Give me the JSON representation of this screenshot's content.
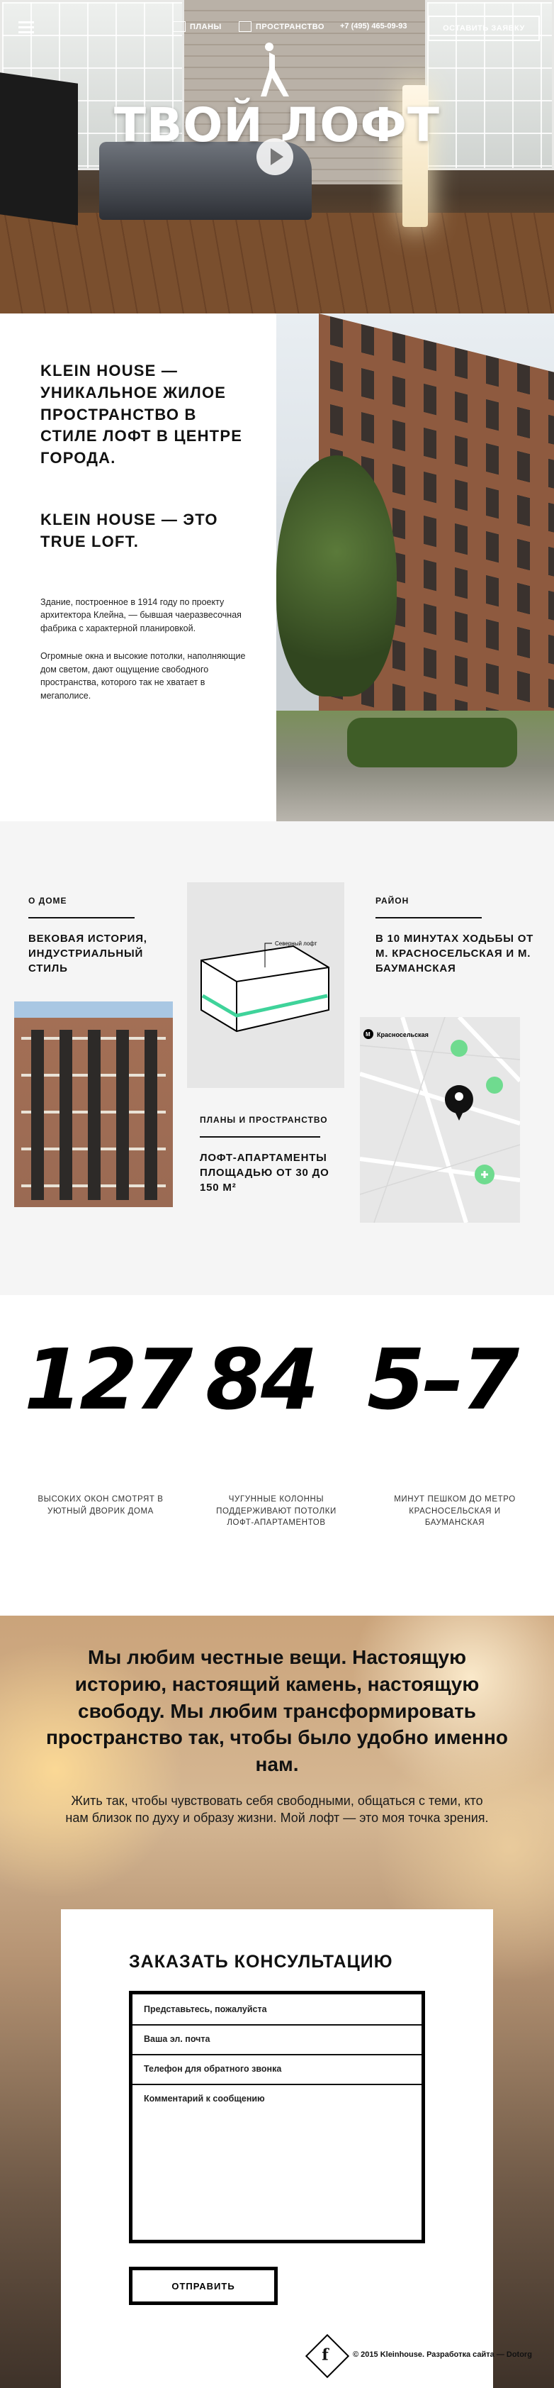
{
  "nav": {
    "plans": "ПЛАНЫ",
    "space": "ПРОСТРАНСТВО",
    "phone": "+7 (495) 465-09-93",
    "cta": "ОСТАВИТЬ ЗАЯВКУ"
  },
  "hero": {
    "title": "ТВОЙ ЛОФТ"
  },
  "intro": {
    "heading1": "KLEIN HOUSE — уникальное жилое пространство в стиле лофт в центре города.",
    "heading2": "KLEIN HOUSE — это TRUE LOFT.",
    "para1": "Здание, построенное в 1914 году по проекту архитектора Клейна, — бывшая чаеразвесочная фабрика с характерной планировкой.",
    "para2": "Огромные окна и высокие потолки, наполняющие дом светом, дают ощущение свободного пространства, которого так не хватает в мегаполисе."
  },
  "about": {
    "house_label": "О ДОМЕ",
    "house_text": "ВЕКОВАЯ ИСТОРИЯ, ИНДУСТРИАЛЬНЫЙ СТИЛЬ",
    "plan_tag": "Северный лофт",
    "plans_label": "ПЛАНЫ И ПРОСТРАНСТВО",
    "plans_text": "ЛОФТ-АПАРТАМЕНТЫ ПЛОЩАДЬЮ ОТ 30 ДО 150 М²",
    "district_label": "РАЙОН",
    "district_text": "В 10 МИНУТАХ ХОДЬБЫ ОТ М. КРАСНОСЕЛЬСКАЯ И М. БАУМАНСКАЯ",
    "map_label": "Красносельская"
  },
  "stats": [
    {
      "num": "127",
      "caption": "ВЫСОКИХ ОКОН СМОТРЯТ В УЮТНЫЙ ДВОРИК ДОМА"
    },
    {
      "num": "84",
      "caption": "ЧУГУННЫЕ КОЛОННЫ ПОДДЕРЖИВАЮТ ПОТОЛКИ ЛОФТ-АПАРТАМЕНТОВ"
    },
    {
      "num": "5–7",
      "caption": "МИНУТ ПЕШКОМ ДО МЕТРО КРАСНОСЕЛЬСКАЯ И БАУМАНСКАЯ"
    }
  ],
  "quote": {
    "strong": "Мы любим честные вещи. Настоящую историю, настоящий камень, настоящую свободу. Мы любим трансформировать пространство так, чтобы было удобно именно нам.",
    "light": "Жить так, чтобы чувствовать себя свободными, общаться с теми, кто нам близок по духу и образу жизни. Мой лофт — это моя точка зрения."
  },
  "form": {
    "title": "ЗАКАЗАТЬ КОНСУЛЬТАЦИЮ",
    "name_label": "Представьтесь, пожалуйста",
    "email_label": "Ваша эл. почта",
    "phone_label": "Телефон для обратного звонка",
    "comment_label": "Комментарий к сообщению",
    "submit": "ОТПРАВИТЬ"
  },
  "footer": {
    "social": "f",
    "copyright": "© 2015 Kleinhouse. Разработка сайта — Dotorg"
  }
}
